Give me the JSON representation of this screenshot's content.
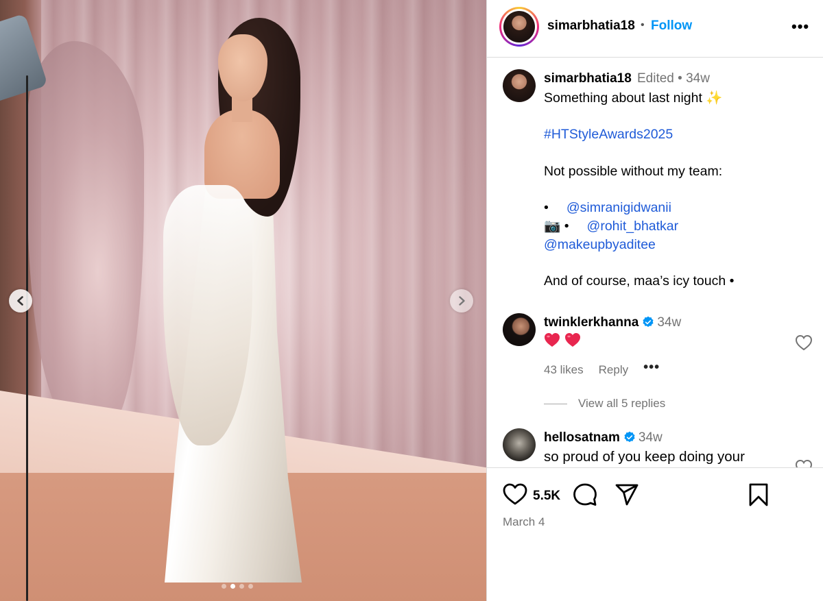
{
  "post": {
    "author": "simarbhatia18",
    "follow_label": "Follow",
    "separator": "•",
    "more_label": "•••",
    "carousel": {
      "slide_count": 4,
      "active_slide": 2
    }
  },
  "caption": {
    "author": "simarbhatia18",
    "meta": "Edited •  34w",
    "line1": "Something about last night ✨",
    "hashtag": "#HTStyleAwards2025",
    "line3": "Not possible without my team:",
    "bullet1_prefix": "•",
    "mention1": "@simranigidwanii",
    "bullet2_prefix": "📷 •",
    "mention2": "@rohit_bhatkar",
    "mention3": "@makeupbyaditee",
    "line6": "And of course, maa’s icy touch •"
  },
  "comments": [
    {
      "author": "twinklerkhanna",
      "time": "34w",
      "text": "❤️❤️",
      "likes": "43 likes",
      "reply_label": "Reply",
      "more_label": "•••",
      "view_replies": "View all 5 replies"
    },
    {
      "author": "hellosatnam",
      "time": "34w",
      "text": "so proud of you keep doing your"
    }
  ],
  "footer": {
    "like_count": "5.5K",
    "date": "March 4"
  },
  "colors": {
    "follow": "#0095f6",
    "hashtag": "#1f5bd8",
    "verified": "#0095f6",
    "heart_emoji": "#e8264f"
  }
}
